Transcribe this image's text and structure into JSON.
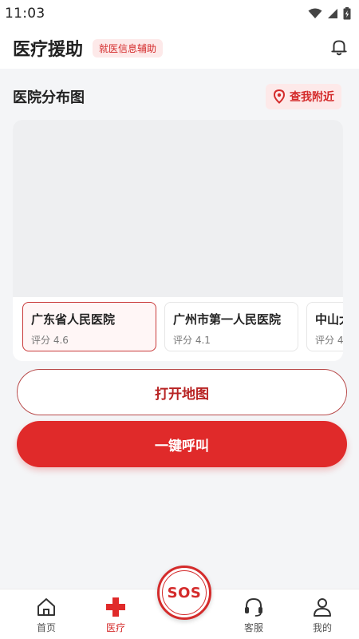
{
  "status_bar": {
    "time": "11:03"
  },
  "header": {
    "title": "医疗援助",
    "badge": "就医信息辅助",
    "bell_icon": "bell-icon"
  },
  "section": {
    "title": "医院分布图",
    "nearby_label": "查我附近",
    "nearby_icon": "location-pin-icon"
  },
  "hospitals": [
    {
      "name": "广东省人民医院",
      "rating": "评分 4.6"
    },
    {
      "name": "广州市第一人民医院",
      "rating": "评分 4.1"
    },
    {
      "name": "中山大学",
      "rating": "评分 4"
    }
  ],
  "actions": {
    "open_map": "打开地图",
    "one_click_call": "一键呼叫"
  },
  "sos_label": "SOS",
  "tabs": [
    {
      "label": "首页",
      "icon": "home-icon"
    },
    {
      "label": "医疗",
      "icon": "medical-cross-icon"
    },
    {
      "label": "客服",
      "icon": "headset-icon"
    },
    {
      "label": "我的",
      "icon": "user-icon"
    }
  ],
  "colors": {
    "accent": "#e02a2a",
    "badge_bg": "#fde9e9",
    "page_bg": "#f4f5f7"
  }
}
